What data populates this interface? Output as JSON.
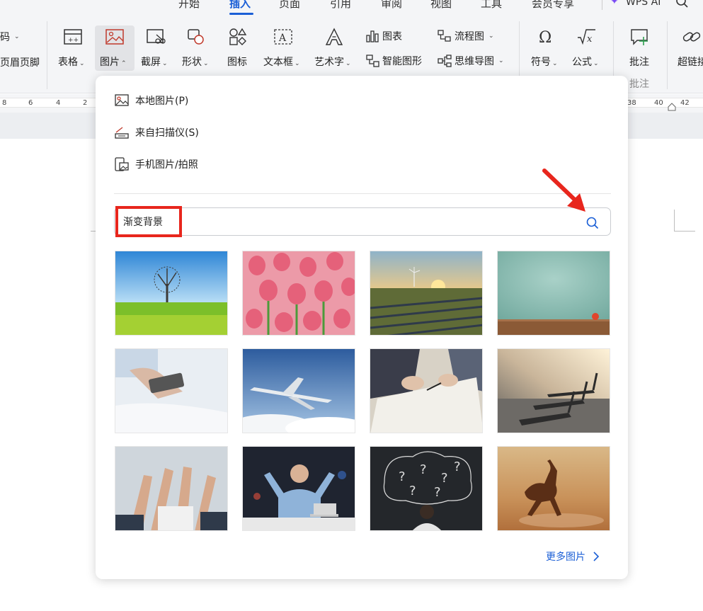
{
  "tabs": [
    {
      "label": "开始",
      "active": false
    },
    {
      "label": "插入",
      "active": true
    },
    {
      "label": "页面",
      "active": false
    },
    {
      "label": "引用",
      "active": false
    },
    {
      "label": "审阅",
      "active": false
    },
    {
      "label": "视图",
      "active": false
    },
    {
      "label": "工具",
      "active": false
    },
    {
      "label": "会员专享",
      "active": false
    }
  ],
  "wps_ai": "WPS AI",
  "ribbon": {
    "left_partial_top": "码",
    "left_partial_bottom": "页眉页脚",
    "table": "表格",
    "picture": "图片",
    "screenshot": "截屏",
    "shape": "形状",
    "icon": "图标",
    "textbox": "文本框",
    "wordart": "艺术字",
    "chart": "图表",
    "smartart": "智能图形",
    "flowchart": "流程图",
    "mindmap": "思维导图",
    "symbol": "符号",
    "formula": "公式",
    "comment": "批注",
    "comment_group": "批注",
    "hyperlink": "超链接"
  },
  "ruler": {
    "left_numbers": [
      "8",
      "6",
      "4",
      "2"
    ],
    "right_numbers": [
      "38",
      "40",
      "42"
    ]
  },
  "picture_menu": {
    "items": [
      {
        "label": "本地图片(P)",
        "icon": "local-image-icon"
      },
      {
        "label": "来自扫描仪(S)",
        "icon": "scanner-icon"
      },
      {
        "label": "手机图片/拍照",
        "icon": "phone-image-icon"
      }
    ],
    "search_value": "渐变背景",
    "more_label": "更多图片",
    "thumbnails": [
      "tree-meadow",
      "pink-tulips",
      "solar-field-sunset",
      "teal-wall-table",
      "hand-phone",
      "airplane-clouds",
      "business-signing",
      "gym-treadmills",
      "team-hands-raised",
      "businessman-celebrating",
      "chalkboard-question-marks",
      "running-horse"
    ]
  },
  "colors": {
    "accent": "#1b5fd6",
    "annotation_red": "#e8261d",
    "ribbon_bg": "#f4f5f7"
  }
}
